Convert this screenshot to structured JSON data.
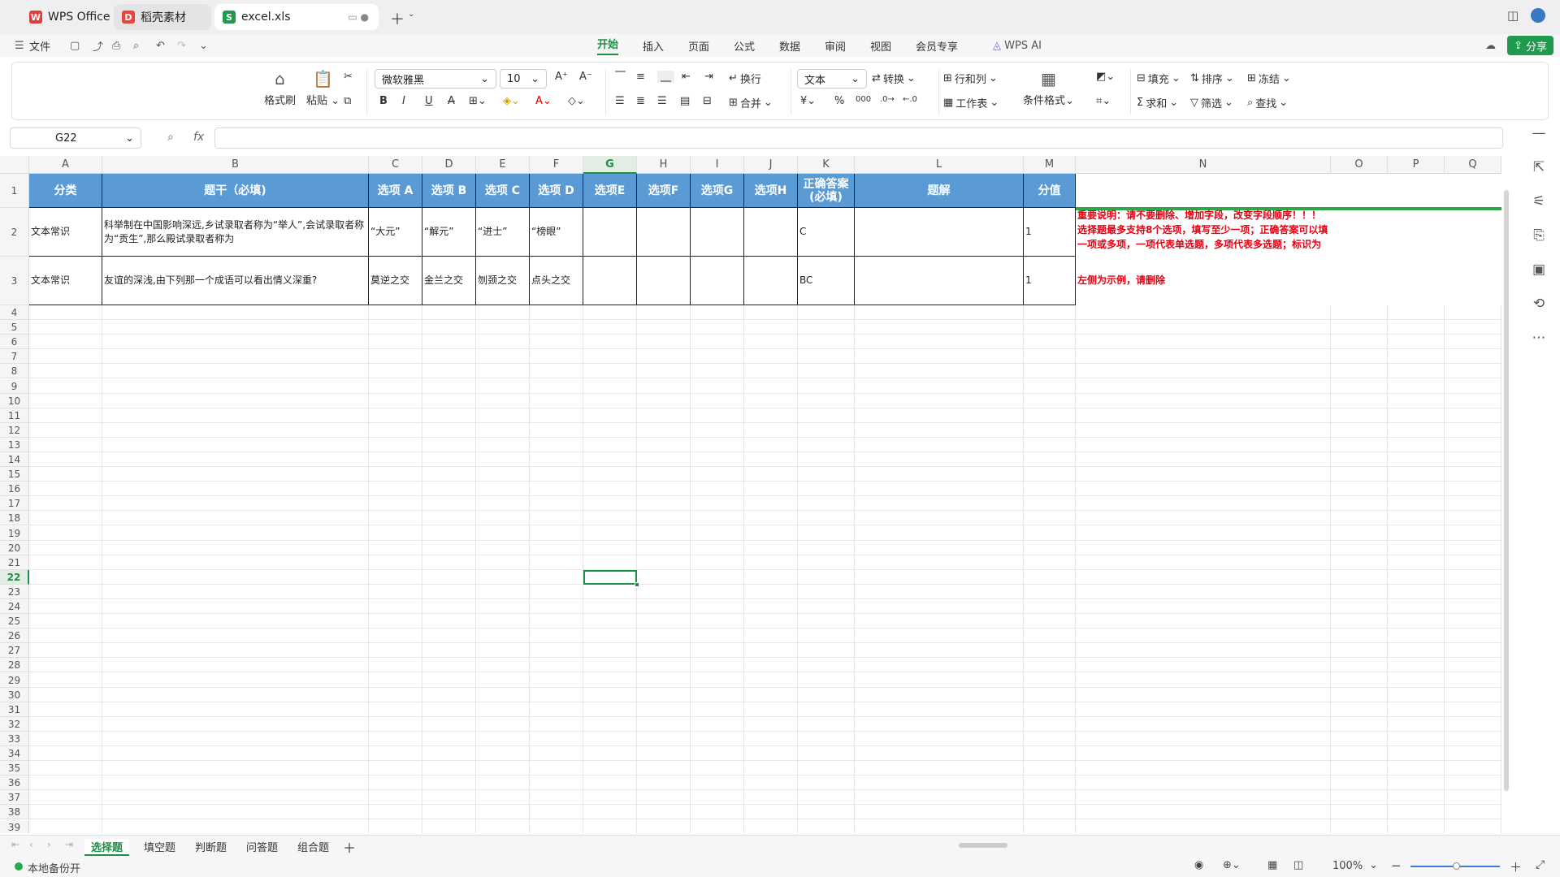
{
  "tabs": {
    "wps": "WPS Office",
    "daoke": "稻壳素材",
    "excel": "excel.xls"
  },
  "menu": {
    "file": "文件",
    "items": [
      "开始",
      "插入",
      "页面",
      "公式",
      "数据",
      "审阅",
      "视图",
      "会员专享"
    ],
    "active_index": 0,
    "ai": "WPS AI",
    "share": "分享"
  },
  "ribbon": {
    "format_painter": "格式刷",
    "paste": "粘贴",
    "font_name": "微软雅黑",
    "font_size": "10",
    "wrap": "换行",
    "merge": "合并",
    "number_format": "文本",
    "convert": "转换",
    "row_col": "行和列",
    "worksheet": "工作表",
    "cond_format": "条件格式",
    "fill": "填充",
    "sort": "排序",
    "freeze": "冻结",
    "sum": "求和",
    "filter": "筛选",
    "find": "查找"
  },
  "formula_bar": {
    "name_box": "G22",
    "fx": "fx",
    "value": ""
  },
  "columns": [
    "A",
    "B",
    "C",
    "D",
    "E",
    "F",
    "G",
    "H",
    "I",
    "J",
    "K",
    "L",
    "M",
    "N",
    "O",
    "P",
    "Q"
  ],
  "selected_cell": "G22",
  "header_row": [
    "分类",
    "题干（必填)",
    "选项 A",
    "选项 B",
    "选项 C",
    "选项 D",
    "选项E",
    "选项F",
    "选项G",
    "选项H",
    "正确答案\n(必填)",
    "题解",
    "分值"
  ],
  "rows": [
    [
      "文本常识",
      "科举制在中国影响深远,乡试录取者称为“举人”,会试录取者称为“贡生”,那么殿试录取者称为",
      "“大元”",
      "“解元”",
      "“进士”",
      "“榜眼”",
      "",
      "",
      "",
      "",
      "C",
      "",
      "1"
    ],
    [
      "文本常识",
      "友谊的深浅,由下列那一个成语可以看出情义深重?",
      "莫逆之交",
      "金兰之交",
      "刎颈之交",
      "点头之交",
      "",
      "",
      "",
      "",
      "BC",
      "",
      "1"
    ]
  ],
  "notes": {
    "important": "重要说明：请不要删除、增加字段，改变字段顺序！！！选择题最多支持8个选项，填写至少一项；正确答案可以填一项或多项，一项代表单选题，多项代表多选题；标识为",
    "example": "左侧为示例，请删除"
  },
  "sheets": [
    "选择题",
    "填空题",
    "判断题",
    "问答题",
    "组合题"
  ],
  "active_sheet": 0,
  "status": {
    "backup": "本地备份开",
    "zoom": "100%"
  },
  "colors": {
    "accent": "#1f8f45",
    "header_fill": "#5b9bd5",
    "note_red": "#e60012"
  }
}
